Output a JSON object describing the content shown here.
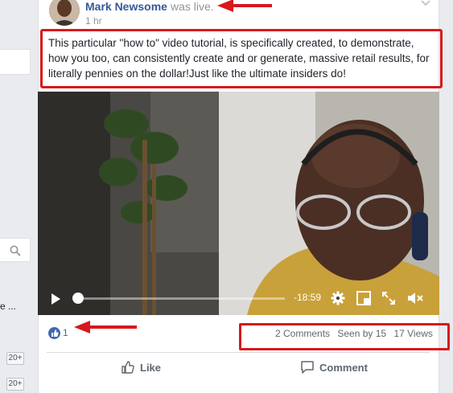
{
  "post": {
    "author_name": "Mark Newsome",
    "author_status": "was live.",
    "timestamp": "1 hr",
    "text": "This particular \"how to\" video tutorial, is specifically created, to demonstrate, how you too, can consistently create and or generate, massive retail results, for literally pennies on the dollar!Just like the ultimate insiders do!"
  },
  "video": {
    "time_remaining": "-18:59",
    "progress": 0.0
  },
  "stats": {
    "reactions_count": "1",
    "comments": "2 Comments",
    "seen_by": "Seen by 15",
    "views": "17 Views"
  },
  "actions": {
    "like_label": "Like",
    "comment_label": "Comment"
  },
  "sidebar": {
    "truncated_text": "e ...",
    "badge_1": "20+",
    "badge_2": "20+"
  },
  "colors": {
    "annotation_red": "#d7191c",
    "link_blue": "#365899",
    "like_blue": "#4267b2"
  }
}
